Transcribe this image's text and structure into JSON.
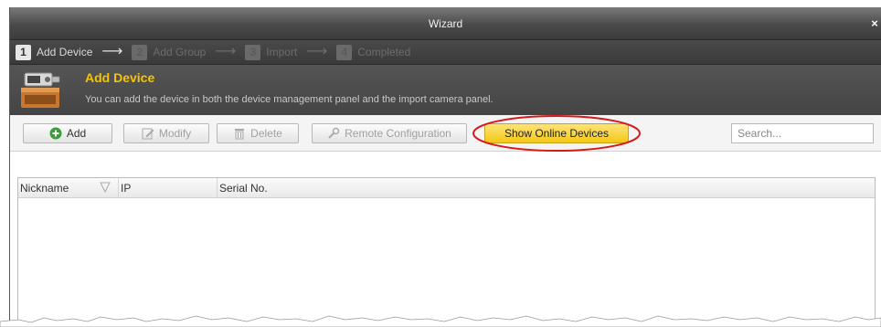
{
  "window": {
    "title": "Wizard",
    "close_glyph": "×"
  },
  "steps": [
    {
      "num": "1",
      "label": "Add Device",
      "active": true
    },
    {
      "num": "2",
      "label": "Add Group",
      "active": false
    },
    {
      "num": "3",
      "label": "Import",
      "active": false
    },
    {
      "num": "4",
      "label": "Completed",
      "active": false
    }
  ],
  "header": {
    "title": "Add Device",
    "description": "You can add the device in both the device management panel and the import camera panel.",
    "icon": "device-recorder-icon"
  },
  "toolbar": {
    "add_label": "Add",
    "modify_label": "Modify",
    "delete_label": "Delete",
    "remote_config_label": "Remote Configuration",
    "show_online_label": "Show Online Devices",
    "search_placeholder": "Search..."
  },
  "table": {
    "columns": [
      "Nickname",
      "IP",
      "Serial No."
    ],
    "rows": []
  },
  "colors": {
    "accent_yellow": "#f5c400",
    "highlight_button": "#f5c816",
    "annotation_red": "#d41a1a"
  }
}
